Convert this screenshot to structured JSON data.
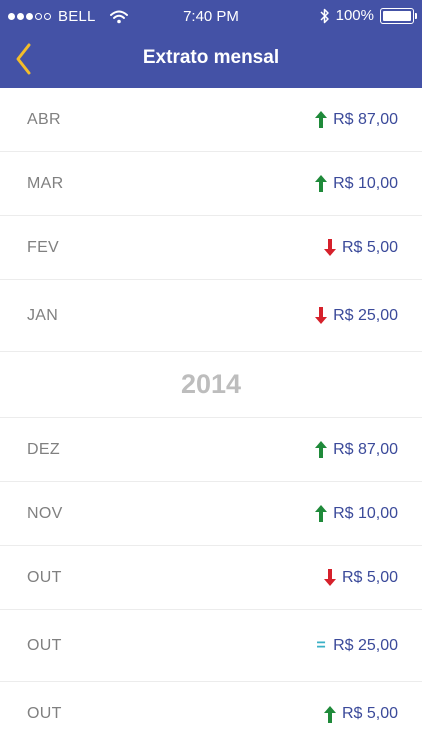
{
  "status": {
    "carrier": "BELL",
    "time": "7:40 PM",
    "battery": "100%"
  },
  "nav": {
    "title": "Extrato mensal"
  },
  "colors": {
    "header": "#4452a6",
    "up": "#1f8a3a",
    "down": "#d6212b",
    "equal": "#3ab0c6",
    "amount": "#3b4a9a"
  },
  "rows_top": [
    {
      "month": "ABR",
      "trend": "up",
      "amount": "R$ 87,00"
    },
    {
      "month": "MAR",
      "trend": "up",
      "amount": "R$ 10,00"
    },
    {
      "month": "FEV",
      "trend": "down",
      "amount": "R$ 5,00"
    },
    {
      "month": "JAN",
      "trend": "down",
      "amount": "R$ 25,00"
    }
  ],
  "year_label": "2014",
  "rows_bottom": [
    {
      "month": "DEZ",
      "trend": "up",
      "amount": "R$ 87,00"
    },
    {
      "month": "NOV",
      "trend": "up",
      "amount": "R$ 10,00"
    },
    {
      "month": "OUT",
      "trend": "down",
      "amount": "R$ 5,00"
    },
    {
      "month": "OUT",
      "trend": "equal",
      "amount": "R$ 25,00",
      "equal_glyph": "="
    },
    {
      "month": "OUT",
      "trend": "up",
      "amount": "R$ 5,00"
    }
  ]
}
